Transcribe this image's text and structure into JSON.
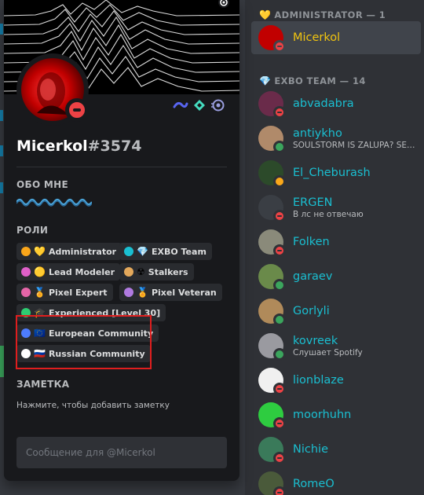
{
  "profile": {
    "username": "Micerkol",
    "discriminator": "#3574",
    "about_header": "ОБО МНЕ",
    "roles_header": "РОЛИ",
    "note_header": "ЗАМЕТКА",
    "note_placeholder": "Нажмите, чтобы добавить заметку",
    "message_placeholder": "Сообщение для @Micerkol",
    "roles": [
      {
        "label": "Administrator",
        "dot": "#faa61a",
        "emoji": "💛"
      },
      {
        "label": "EXBO Team",
        "dot": "#1abfd1",
        "emoji": "💎"
      },
      {
        "label": "Lead Modeler",
        "dot": "#e060c9",
        "emoji": "🟡"
      },
      {
        "label": "Stalkers",
        "dot": "#e3a85b",
        "emoji": "☢"
      },
      {
        "label": "Pixel Expert",
        "dot": "#e565a8",
        "emoji": "🏅"
      },
      {
        "label": "Pixel Veteran",
        "dot": "#b07ae0",
        "emoji": "🏅"
      },
      {
        "label": "Experienced [Level 30]",
        "dot": "#2ecc71",
        "emoji": "🎓"
      },
      {
        "label": "European Community",
        "dot": "#4d7cff",
        "emoji": "🇪🇺"
      },
      {
        "label": "Russian Community",
        "dot": "#ffffff",
        "emoji": "🇷🇺"
      }
    ]
  },
  "members": {
    "groups": [
      {
        "header": "ADMINISTRATOR — 1",
        "icon": "heart-icon"
      },
      {
        "header": "EXBO TEAM — 14",
        "icon": "diamond-icon"
      }
    ],
    "admin": [
      {
        "name": "Micerkol",
        "color": "#f1c40f",
        "status": "dnd",
        "sub": "",
        "avatar": "#c10000"
      }
    ],
    "team": [
      {
        "name": "abvadabra",
        "color": "#1abfd1",
        "status": "dnd",
        "sub": "",
        "avatar": "#6a2b4a"
      },
      {
        "name": "antiykho",
        "color": "#1abfd1",
        "status": "online",
        "sub": "SOULSTORM IS ZALUPA? SEC...",
        "avatar": "#b08a6a"
      },
      {
        "name": "El_Cheburash",
        "color": "#1abfd1",
        "status": "idle",
        "sub": "",
        "avatar": "#2c4a2a"
      },
      {
        "name": "ERGEN",
        "color": "#1abfd1",
        "status": "dnd",
        "sub": "В лс не отвечаю",
        "avatar": "#3a3e44"
      },
      {
        "name": "Folken",
        "color": "#1abfd1",
        "status": "dnd",
        "sub": "",
        "avatar": "#8a8a7a"
      },
      {
        "name": "garaev",
        "color": "#1abfd1",
        "status": "online",
        "sub": "",
        "avatar": "#6a8a4a"
      },
      {
        "name": "Gorlyli",
        "color": "#1abfd1",
        "status": "online",
        "sub": "",
        "avatar": "#b08a5a"
      },
      {
        "name": "kovreek",
        "color": "#1abfd1",
        "status": "online",
        "sub": "Слушает Spotify",
        "avatar": "#9a9aa0"
      },
      {
        "name": "lionblaze",
        "color": "#1abfd1",
        "status": "dnd",
        "sub": "",
        "avatar": "#f0f0f0"
      },
      {
        "name": "moorhuhn",
        "color": "#1abfd1",
        "status": "dnd",
        "sub": "",
        "avatar": "#2ecc40"
      },
      {
        "name": "Nichie",
        "color": "#1abfd1",
        "status": "dnd",
        "sub": "",
        "avatar": "#3a7a5a"
      },
      {
        "name": "RomeO",
        "color": "#1abfd1",
        "status": "dnd",
        "sub": "",
        "avatar": "#4a5a3a"
      }
    ]
  }
}
